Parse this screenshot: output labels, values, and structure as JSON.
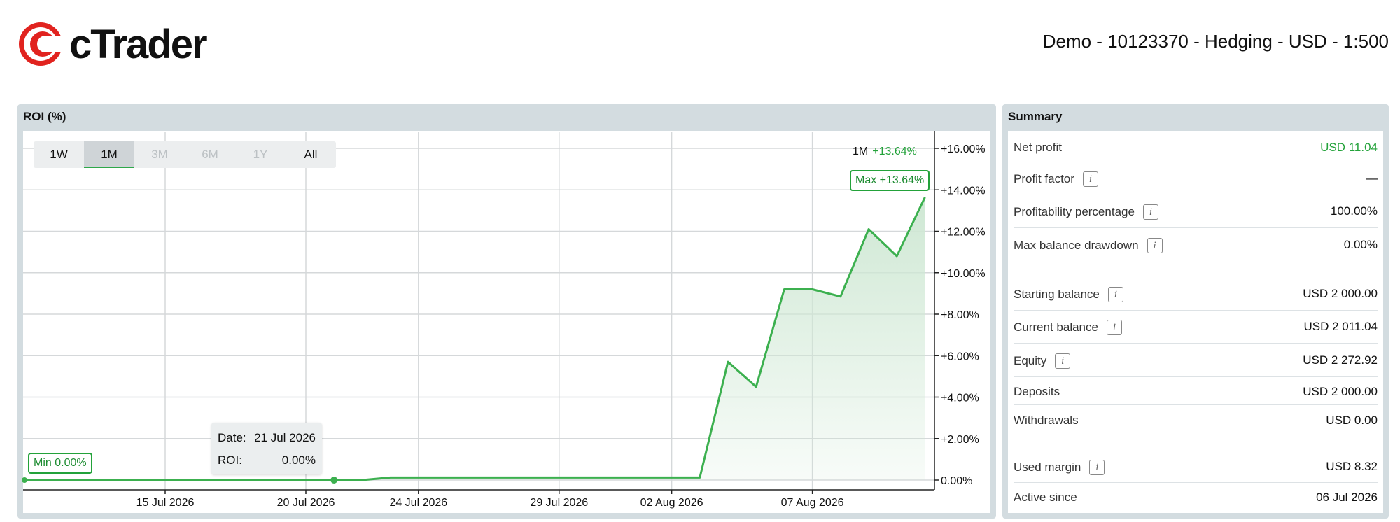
{
  "header": {
    "logo_text": "cTrader",
    "account_info": "Demo - 10123370 - Hedging - USD - 1:500"
  },
  "roi_panel": {
    "title": "ROI (%)",
    "tabs": [
      {
        "label": "1W",
        "state": "normal"
      },
      {
        "label": "1M",
        "state": "active"
      },
      {
        "label": "3M",
        "state": "disabled"
      },
      {
        "label": "6M",
        "state": "disabled"
      },
      {
        "label": "1Y",
        "state": "disabled"
      },
      {
        "label": "All",
        "state": "normal"
      }
    ],
    "range_period": "1M",
    "range_change": "+13.64%",
    "max_label": "Max +13.64%",
    "min_label": "Min 0.00%",
    "tooltip": {
      "date_label": "Date:",
      "date_value": "21 Jul 2026",
      "roi_label": "ROI:",
      "roi_value": "0.00%"
    }
  },
  "chart_data": {
    "type": "area",
    "y_tick_labels": [
      "+16.00%",
      "+14.00%",
      "+12.00%",
      "+10.00%",
      "+8.00%",
      "+6.00%",
      "+4.00%",
      "+2.00%",
      "0.00%"
    ],
    "ylim": [
      0,
      16
    ],
    "x_tick_labels": [
      "15 Jul 2026",
      "20 Jul 2026",
      "24 Jul 2026",
      "29 Jul 2026",
      "02 Aug 2026",
      "07 Aug 2026"
    ],
    "series": [
      {
        "points": [
          [
            "2026-07-10",
            0.0
          ],
          [
            "2026-07-21",
            0.0
          ],
          [
            "2026-07-22",
            0.0
          ],
          [
            "2026-07-23",
            0.12
          ],
          [
            "2026-08-03",
            0.12
          ],
          [
            "2026-08-04",
            5.7
          ],
          [
            "2026-08-05",
            4.5
          ],
          [
            "2026-08-06",
            9.2
          ],
          [
            "2026-08-07",
            9.2
          ],
          [
            "2026-08-08",
            8.85
          ],
          [
            "2026-08-09",
            12.1
          ],
          [
            "2026-08-10",
            10.8
          ],
          [
            "2026-08-11",
            13.64
          ]
        ]
      }
    ],
    "highlight_point": [
      "2026-07-21",
      0.0
    ],
    "colors": {
      "line": "#3cb04f",
      "area_top": "#cfe8d4",
      "grid": "#d5d8da"
    }
  },
  "summary": {
    "title": "Summary",
    "rows": [
      {
        "label": "Net profit",
        "value": "USD 11.04",
        "info": false,
        "green": true
      },
      {
        "label": "Profit factor",
        "value": "—",
        "info": true
      },
      {
        "label": "Profitability percentage",
        "value": "100.00%",
        "info": true
      },
      {
        "label": "Max balance drawdown",
        "value": "0.00%",
        "info": true
      },
      {
        "label": "Starting balance",
        "value": "USD 2 000.00",
        "info": true
      },
      {
        "label": "Current balance",
        "value": "USD 2 011.04",
        "info": true
      },
      {
        "label": "Equity",
        "value": "USD 2 272.92",
        "info": true
      },
      {
        "label": "Deposits",
        "value": "USD 2 000.00",
        "info": false
      },
      {
        "label": "Withdrawals",
        "value": "USD 0.00",
        "info": false
      },
      {
        "label": "Used margin",
        "value": "USD 8.32",
        "info": true
      },
      {
        "label": "Active since",
        "value": "06 Jul 2026",
        "info": false
      }
    ],
    "info_glyph": "i"
  }
}
